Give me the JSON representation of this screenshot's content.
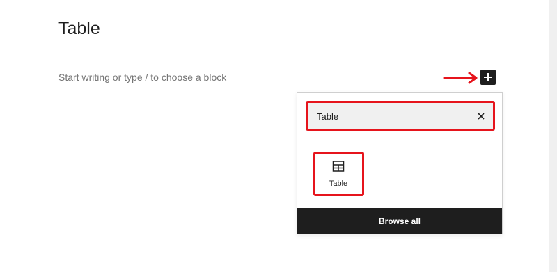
{
  "editor": {
    "title": "Table",
    "placeholder": "Start writing or type / to choose a block"
  },
  "inserter": {
    "search_value": "Table",
    "result_label": "Table",
    "browse_all_label": "Browse all"
  },
  "icons": {
    "inserter": "plus-icon",
    "clear": "close-icon",
    "table": "table-icon",
    "arrow": "arrow-right-icon"
  },
  "colors": {
    "annotation": "#e6141c",
    "dark": "#1e1e1e",
    "placeholder_text": "#757575"
  }
}
